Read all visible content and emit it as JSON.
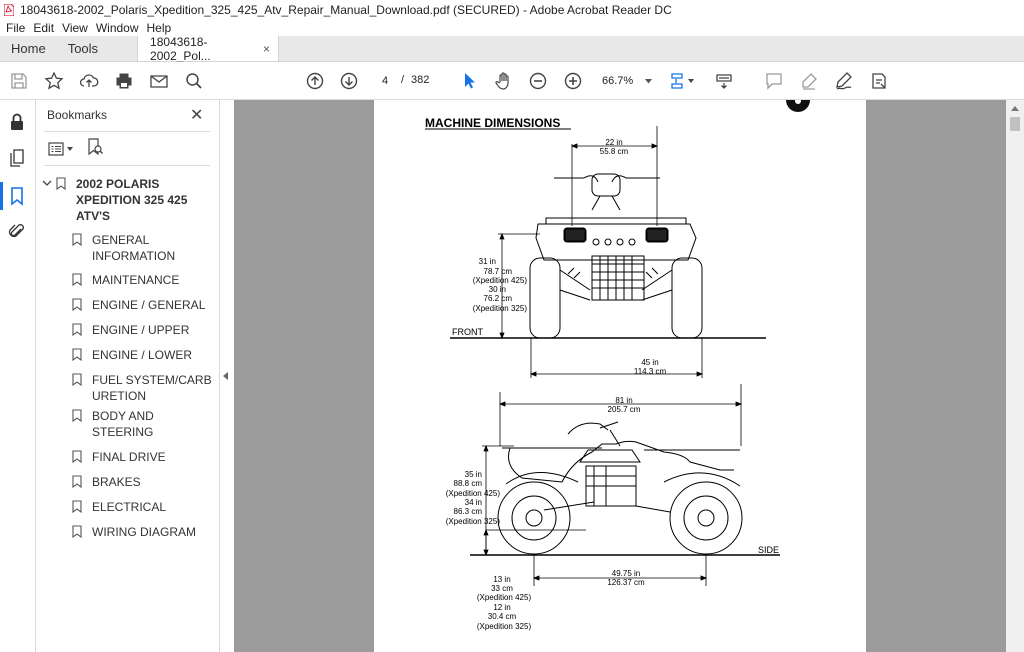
{
  "window": {
    "title": "18043618-2002_Polaris_Xpedition_325_425_Atv_Repair_Manual_Download.pdf (SECURED) - Adobe Acrobat Reader DC"
  },
  "menu": [
    "File",
    "Edit",
    "View",
    "Window",
    "Help"
  ],
  "tabs": {
    "home": "Home",
    "tools": "Tools",
    "document": "18043618-2002_Pol...",
    "close": "×"
  },
  "toolbar": {
    "current_page": "4",
    "separator": "/",
    "total_pages": "382",
    "zoom": "66.7%"
  },
  "bookmarks": {
    "header": "Bookmarks",
    "close": "✕",
    "root": "2002 POLARIS XPEDITION 325 425 ATV'S",
    "items": [
      "GENERAL INFORMATION",
      "MAINTENANCE",
      "ENGINE / GENERAL",
      "ENGINE / UPPER",
      "ENGINE / LOWER",
      "FUEL SYSTEM/CARBURETION",
      "BODY AND STEERING",
      "FINAL DRIVE",
      "BRAKES",
      "ELECTRICAL",
      "WIRING DIAGRAM"
    ]
  },
  "document": {
    "heading": "MACHINE DIMENSIONS",
    "front": {
      "view_label": "FRONT",
      "width_top": [
        "22 in",
        "55.8 cm"
      ],
      "height": [
        "31 in",
        "78.7 cm",
        "(Xpedition 425)",
        "30 in",
        "76.2 cm",
        "(Xpedition 325)"
      ],
      "track": [
        "45 in",
        "114.3 cm"
      ]
    },
    "side": {
      "view_label": "SIDE",
      "length": [
        "81 in",
        "205.7 cm"
      ],
      "height": [
        "35 in",
        "88.8 cm",
        "(Xpedition 425)",
        "34 in",
        "86.3 cm",
        "(Xpedition 325)"
      ],
      "clearance": [
        "13 in",
        "33 cm",
        "(Xpedition 425)",
        "12 in",
        "30.4 cm",
        "(Xpedition 325)"
      ],
      "wheelbase": [
        "49.75 in",
        "126.37 cm"
      ]
    }
  }
}
